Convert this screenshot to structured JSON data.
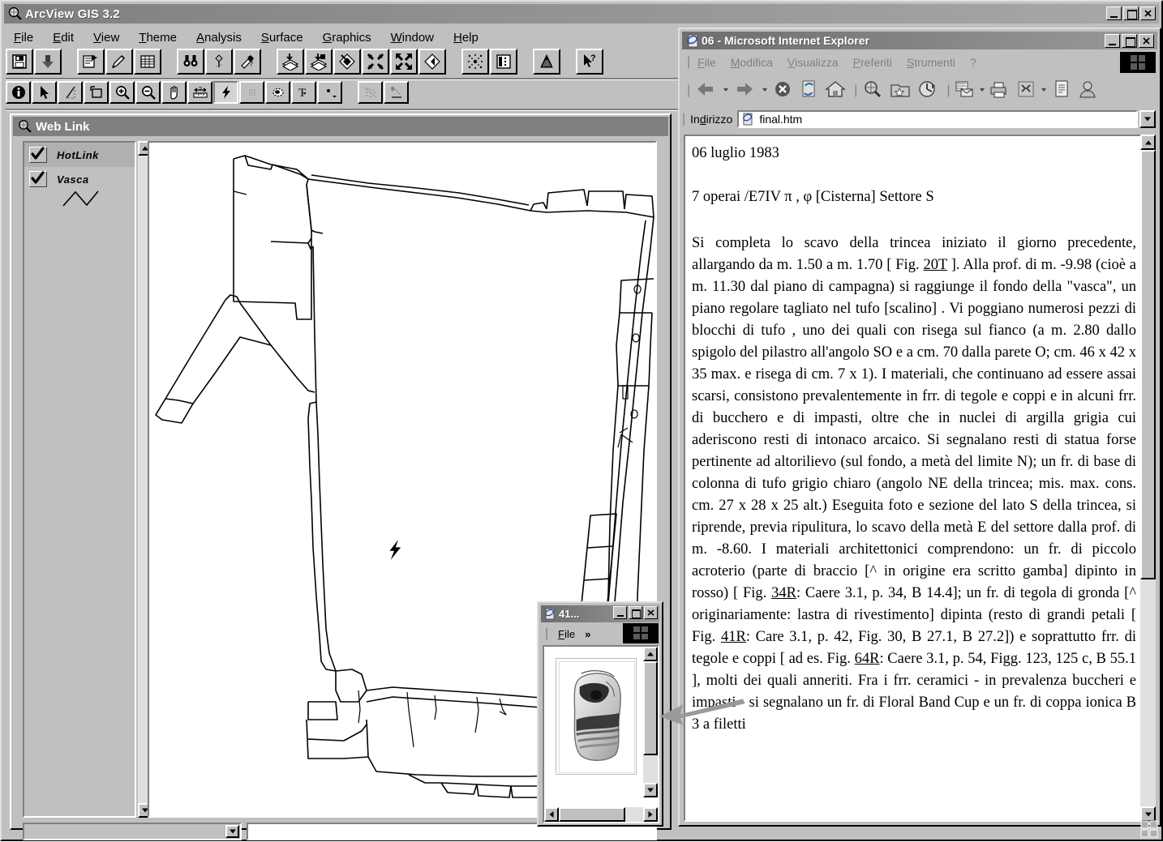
{
  "arcview": {
    "title": "ArcView GIS 3.2",
    "app_icon": "magnifier-globe-icon",
    "window_buttons": [
      "minimize",
      "maximize",
      "close"
    ],
    "menu": [
      "File",
      "Edit",
      "View",
      "Theme",
      "Analysis",
      "Surface",
      "Graphics",
      "Window",
      "Help"
    ],
    "toolbar_row1": [
      "save-project-icon",
      "add-theme-icon",
      "theme-properties-icon",
      "edit-legend-icon",
      "open-table-icon",
      "find-icon",
      "locate-address-icon",
      "query-builder-icon",
      "zoom-to-themes-icon",
      "zoom-to-selected-icon",
      "clear-selected-icon",
      "zoom-in-fixed-icon",
      "zoom-out-fixed-icon",
      "zoom-previous-icon",
      "select-features-icon",
      "open-layout-icon",
      "chart-icon",
      "help-pointer-icon"
    ],
    "toolbar_row2": [
      "identify-icon",
      "pointer-icon",
      "vertex-edit-icon",
      "select-box-icon",
      "zoom-in-icon",
      "zoom-out-icon",
      "pan-hand-icon",
      "measure-icon",
      "hotlink-lightning-icon",
      "area-of-interest-icon",
      "select-circle-icon",
      "text-tool-icon",
      "draw-point-icon",
      "legend-tool-icon",
      "scale-tool-icon"
    ],
    "active_tool": "hotlink-lightning-icon",
    "view_window": {
      "title": "Web Link",
      "icon": "view-magnifier-icon",
      "legend": [
        {
          "label": "HotLink",
          "checked": true,
          "selected": true,
          "symbol": "none"
        },
        {
          "label": "Vasca",
          "checked": true,
          "selected": false,
          "symbol": "zigzag-line"
        }
      ],
      "map": {
        "description": "archaeological excavation plan of a cistern / vasca, black line drawing on white",
        "hotlink_marker": "lightning-bolt"
      }
    }
  },
  "ie": {
    "title": "06 - Microsoft Internet Explorer",
    "app_icon": "ie-page-icon",
    "window_buttons": [
      "minimize",
      "maximize",
      "close"
    ],
    "menu": [
      "File",
      "Modifica",
      "Visualizza",
      "Preferiti",
      "Strumenti",
      "?"
    ],
    "toolbar": [
      "back-arrow-icon",
      "back-dropdown-icon",
      "forward-arrow-icon",
      "forward-dropdown-icon",
      "stop-icon",
      "refresh-icon",
      "home-icon",
      "search-icon",
      "favorites-icon",
      "history-icon",
      "mail-icon",
      "mail-dropdown-icon",
      "print-icon",
      "edit-icon",
      "edit-dropdown-icon",
      "discuss-icon",
      "messenger-icon"
    ],
    "address_label": "Indirizzo",
    "address_value": "final.htm",
    "address_placeholder": "final.htm",
    "address_dropdown_icon": "chevron-down-icon",
    "brand_logo": "ie-animated-logo",
    "document": {
      "date": "06 luglio 1983",
      "header": "7 operai /E7IV π , φ [Cisterna]  Settore S",
      "body_parts": [
        {
          "t": "Si completa lo scavo della trincea iniziato il giorno precedente, allargando da m. 1.50 a m. 1.70 [ Fig. "
        },
        {
          "t": "20T",
          "link": true
        },
        {
          "t": " ]. Alla prof. di m. -9.98 (cioè a m. 11.30 dal piano di campagna) si raggiunge il fondo della \"vasca\", un piano regolare tagliato nel tufo [scalino] . Vi poggiano numerosi pezzi di blocchi di tufo , uno dei quali con risega sul fianco (a m. 2.80 dallo spigolo del pilastro all'angolo SO e a cm. 70 dalla parete O; cm. 46 x 42 x 35 max. e risega di cm. 7 x 1). I materiali, che continuano ad essere assai scarsi, consistono prevalentemente in frr. di tegole e coppi e in alcuni frr. di bucchero e di impasti, oltre che in nuclei di argilla grigia cui aderiscono resti di intonaco arcaico. Si segnalano resti di statua forse pertinente ad altorilievo (sul fondo, a metà del limite N); un fr. di base di colonna di tufo grigio chiaro (angolo NE della trincea; mis. max. cons. cm. 27 x 28 x 25 alt.) Eseguita foto e sezione del lato S della trincea, si riprende, previa ripulitura, lo scavo della metà E del settore dalla prof. di m. -8.60. I materiali architettonici comprendono: un fr. di piccolo acroterio (parte di braccio [^ in origine era scritto gamba] dipinto in rosso) [ Fig. "
        },
        {
          "t": "34R",
          "link": true
        },
        {
          "t": ": Caere 3.1, p. 34, B 14.4]; un fr. di tegola di gronda [^ originariamente: lastra di rivestimento] dipinta (resto di grandi petali [ Fig. "
        },
        {
          "t": "41R",
          "link": true
        },
        {
          "t": ": Care 3.1, p. 42, Fig. 30, B 27.1, B 27.2]) e soprattutto frr. di tegole e coppi [ ad es. Fig. "
        },
        {
          "t": "64R",
          "link": true
        },
        {
          "t": ": Caere 3.1, p. 54, Figg. 123, 125 c, B 55.1 ], molti dei quali anneriti. Fra i frr. ceramici - in prevalenza buccheri e impasti - si segnalano un fr. di Floral Band Cup e un fr. di coppa ionica B 3 a filetti"
        }
      ]
    }
  },
  "image_window": {
    "title": "41...",
    "app_icon": "ie-page-icon",
    "window_buttons": [
      "minimize",
      "maximize",
      "close"
    ],
    "menu": [
      "File"
    ],
    "overflow_label": "»",
    "brand_logo": "ie-animated-logo",
    "image_alt": "photo of a pottery fragment (tegola di gronda dipinta)"
  },
  "annotation": {
    "pointer": "left-arrow-callout"
  },
  "colors": {
    "face": "#c0c0c0",
    "titlebar_active": "#808080",
    "titlebar_text": "#ffffff",
    "window_text": "#000000",
    "disabled_text": "#808080",
    "canvas": "#ffffff"
  }
}
